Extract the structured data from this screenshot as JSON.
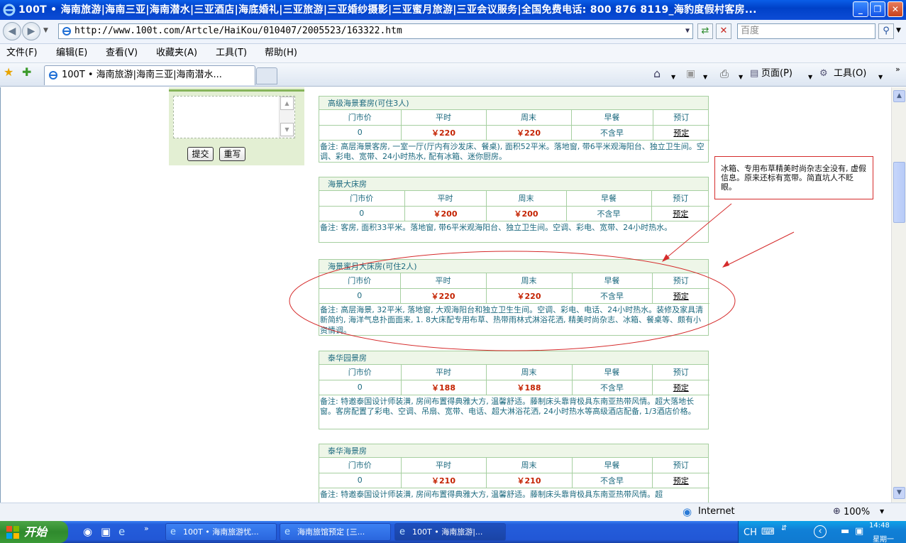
{
  "window": {
    "title": "100T • 海南旅游|海南三亚|海南潜水|三亚酒店|海底婚礼|三亚旅游|三亚婚纱摄影|三亚蜜月旅游|三亚会议服务|全国免费电话: 800 876 8119_海豹度假村客房..."
  },
  "address_bar": {
    "url": "http://www.100t.com/Artcle/HaiKou/010407/2005523/163322.htm",
    "search_placeholder": "百度"
  },
  "menu": [
    "文件(F)",
    "编辑(E)",
    "查看(V)",
    "收藏夹(A)",
    "工具(T)",
    "帮助(H)"
  ],
  "tab": {
    "label": "100T • 海南旅游|海南三亚|海南潜水..."
  },
  "toolbar": {
    "page_label": "页面(P)",
    "tools_label": "工具(O)"
  },
  "form": {
    "submit_label": "提交",
    "reset_label": "重写"
  },
  "table_headers": [
    "门市价",
    "平时",
    "周末",
    "早餐",
    "预订"
  ],
  "rooms": [
    {
      "title": "高级海景套房(可住3人)",
      "list_price": "0",
      "weekday": "￥220",
      "weekend": "￥220",
      "breakfast": "不含早",
      "book": "预定",
      "note": "备注: 高层海景客房, 一室一厅(厅内有沙发床、餐桌), 面积52平米。落地窗, 带6平米观海阳台、独立卫生间。空调、彩电、宽带、24小时热水, 配有冰箱、迷你厨房。"
    },
    {
      "title": "海景大床房",
      "list_price": "0",
      "weekday": "￥200",
      "weekend": "￥200",
      "breakfast": "不含早",
      "book": "预定",
      "note": "备注: 客房, 面积33平米。落地窗, 带6平米观海阳台、独立卫生间。空调、彩电、宽带、24小时热水。"
    },
    {
      "title": "海景蜜月大床房(可住2人)",
      "list_price": "0",
      "weekday": "￥220",
      "weekend": "￥220",
      "breakfast": "不含早",
      "book": "预定",
      "note": "备注: 高层海景, 32平米, 落地窗, 大观海阳台和独立卫生生间。空调、彩电、电话、24小时热水。装修及家具清新简约, 海洋气息扑面面来, 1. 8大床配专用布草、热带雨林式淋浴花洒, 精美时尚杂志、冰箱、餐桌等、颇有小资情调。"
    },
    {
      "title": "泰华园景房",
      "list_price": "0",
      "weekday": "￥188",
      "weekend": "￥188",
      "breakfast": "不含早",
      "book": "预定",
      "note": "备注: 特邀泰国设计师装潢, 房间布置得典雅大方, 温馨舒适。藤制床头靠背极具东南亚热带风情。超大落地长窗。客房配置了彩电、空调、吊扇、宽带、电话、超大淋浴花洒, 24小时热水等高级酒店配备, 1/3酒店价格。"
    },
    {
      "title": "泰华海景房",
      "list_price": "0",
      "weekday": "￥210",
      "weekend": "￥210",
      "breakfast": "不含早",
      "book": "预定",
      "note": "备注: 特邀泰国设计师装潢, 房间布置得典雅大方, 温馨舒适。藤制床头靠背极具东南亚热带风情。超"
    }
  ],
  "annotation": {
    "text": "冰箱、专用布草精美时尚杂志全没有, 虚假信息。原来还标有宽带。简直坑人不眨眼。",
    "color": "#d52b2b"
  },
  "status": {
    "zone": "Internet",
    "zoom": "100%"
  },
  "taskbar": {
    "start_label": "开始",
    "tasks": [
      "100T • 海南旅游忧...",
      "海南旅馆预定 [三...",
      "100T • 海南旅游|..."
    ],
    "lang": "CH",
    "time": "14:48",
    "weekday": "星期一"
  },
  "colors": {
    "accent_title": "#0041c8",
    "price": "#c42200",
    "table_text": "#1d6a7f",
    "border": "#a6cfa0"
  }
}
